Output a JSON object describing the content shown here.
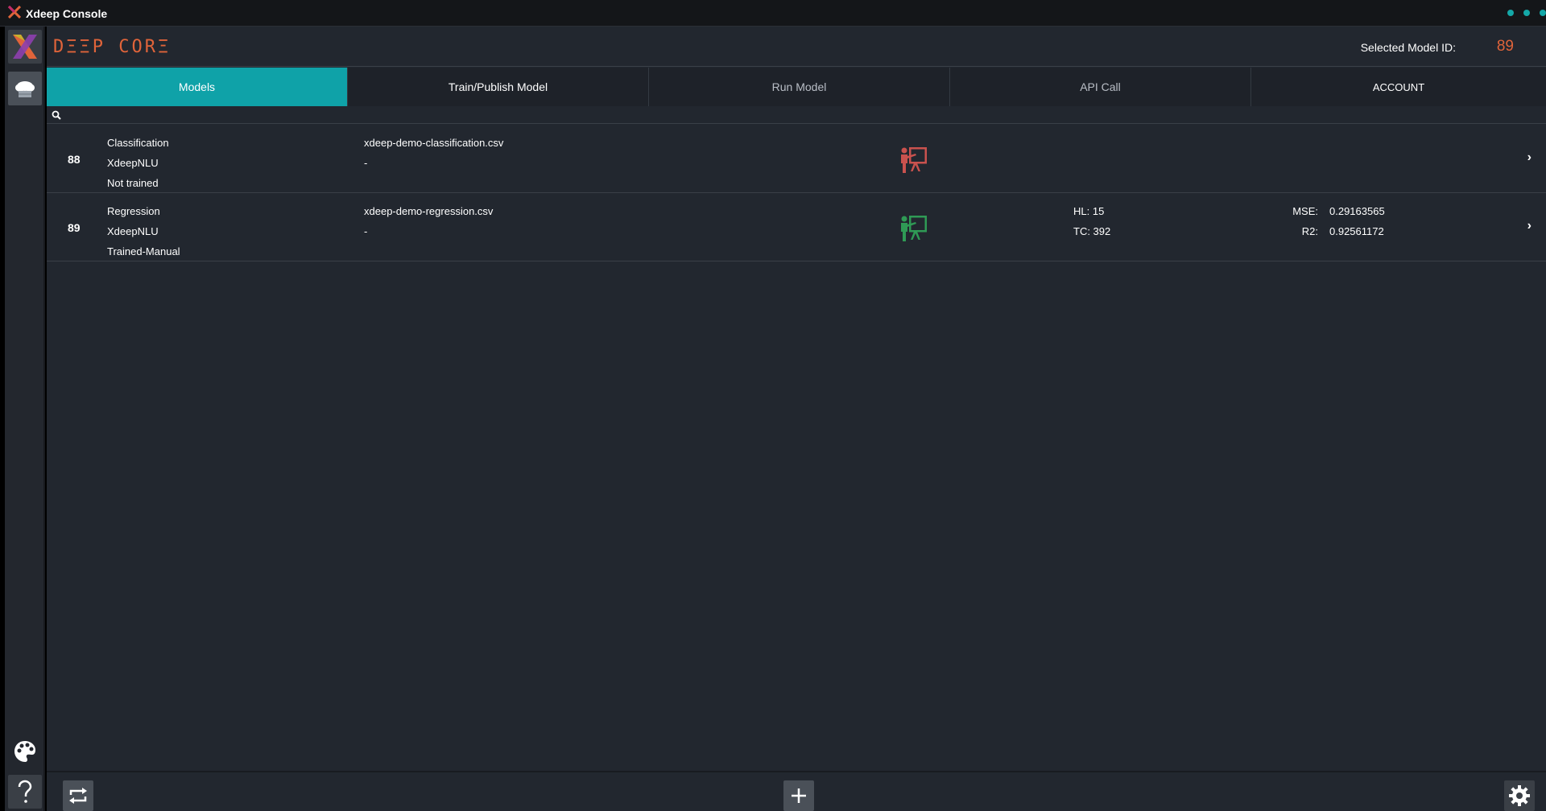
{
  "window": {
    "title": "Xdeep Console"
  },
  "header": {
    "brand": "DΞΞP CORΞ",
    "selected_label": "Selected Model ID:",
    "selected_value": "89"
  },
  "tabs": [
    {
      "label": "Models",
      "active": true
    },
    {
      "label": "Train/Publish Model",
      "active": false
    },
    {
      "label": "Run Model",
      "active": false
    },
    {
      "label": "API Call",
      "active": false
    },
    {
      "label": "ACCOUNT",
      "active": false
    }
  ],
  "search": {
    "placeholder": ""
  },
  "models": [
    {
      "id": "88",
      "type": "Classification",
      "engine": "XdeepNLU",
      "status": "Not trained",
      "file": "xdeep-demo-classification.csv",
      "note": "-",
      "status_icon": "presentation-icon",
      "status_color": "#c9524e",
      "hl": "",
      "tc": "",
      "mse_label": "",
      "mse": "",
      "r2_label": "",
      "r2": ""
    },
    {
      "id": "89",
      "type": "Regression",
      "engine": "XdeepNLU",
      "status": "Trained-Manual",
      "file": "xdeep-demo-regression.csv",
      "note": "-",
      "status_icon": "presentation-icon",
      "status_color": "#2f9a55",
      "hl": "HL: 15",
      "tc": "TC: 392",
      "mse_label": "MSE:",
      "mse": "0.29163565",
      "r2_label": "R2:",
      "r2": "0.92561172"
    }
  ],
  "colors": {
    "accent": "#0fa2a8",
    "brand": "#e0643a",
    "background": "#22272f"
  }
}
